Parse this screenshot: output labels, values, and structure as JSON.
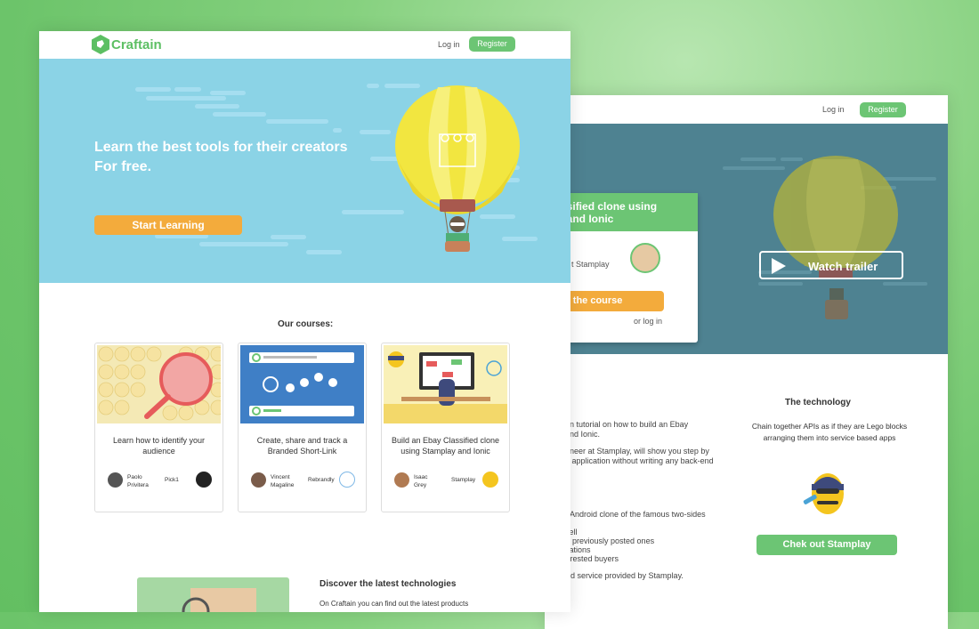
{
  "back_window": {
    "nav": {
      "login": "Log in",
      "register": "Register"
    },
    "course_card": {
      "title": "lassified clone using\nay and Ionic",
      "sub": "t Stamplay",
      "cta": "o the course",
      "or_login": "or log in"
    },
    "trailer": "Watch trailer",
    "body_lines": [
      "ftain tutorial on how to build an Ebay",
      "y and Ionic.",
      "ngineer at Stamplay, will show you step by",
      "ole application without writing any back-end",
      "nd Android clone of the famous two-sides",
      "s sell",
      "the previously posted ones",
      "locations",
      "nterested buyers",
      "-end service provided by Stamplay."
    ],
    "tech": {
      "heading": "The technology",
      "desc": "Chain together APIs as if they are Lego blocks arranging them into service based apps",
      "button": "Chek out Stamplay"
    }
  },
  "front_window": {
    "brand": "Craftain",
    "nav": {
      "login": "Log in",
      "register": "Register"
    },
    "hero": {
      "line1": "Learn the best tools for their creators",
      "line2": "For free.",
      "button": "Start Learning"
    },
    "courses_heading": "Our courses:",
    "courses": [
      {
        "title": "Learn how to identify your audience",
        "author_first": "Paolo",
        "author_last": "Privitera",
        "brand": "Pick1"
      },
      {
        "title": "Create, share and track a Branded Short-Link",
        "author_first": "Vincent",
        "author_last": "Magaline",
        "brand": "Rebrandly"
      },
      {
        "title": "Build an Ebay Classified clone using Stamplay and Ionic",
        "author_first": "Isaac",
        "author_last": "Grey",
        "brand": "Stamplay"
      }
    ],
    "discover": {
      "heading": "Discover the latest technologies",
      "desc": "On Craftain you can find out the latest products"
    }
  },
  "colors": {
    "green": "#6cc574",
    "orange": "#f3ab3c",
    "sky": "#8bd3e6",
    "dark_sky": "#4e8291"
  }
}
